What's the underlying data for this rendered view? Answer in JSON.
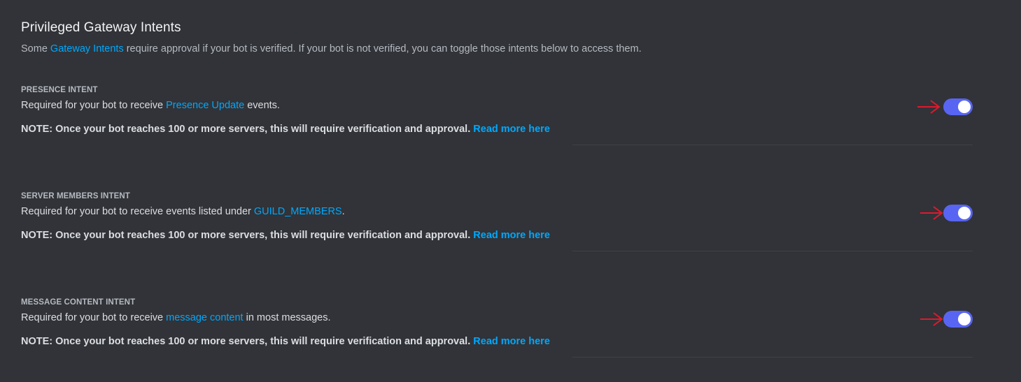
{
  "header": {
    "title": "Privileged Gateway Intents",
    "desc_prefix": "Some ",
    "desc_link": "Gateway Intents",
    "desc_suffix": " require approval if your bot is verified. If your bot is not verified, you can toggle those intents below to access them."
  },
  "intents": [
    {
      "title": "PRESENCE INTENT",
      "desc_prefix": "Required for your bot to receive ",
      "desc_link": "Presence Update",
      "desc_suffix": " events.",
      "note": "NOTE: Once your bot reaches 100 or more servers, this will require verification and approval.",
      "note_link": "Read more here",
      "enabled": true
    },
    {
      "title": "SERVER MEMBERS INTENT",
      "desc_prefix": "Required for your bot to receive events listed under ",
      "desc_link": "GUILD_MEMBERS",
      "desc_suffix": ".",
      "note": "NOTE: Once your bot reaches 100 or more servers, this will require verification and approval.",
      "note_link": "Read more here",
      "enabled": true
    },
    {
      "title": "MESSAGE CONTENT INTENT",
      "desc_prefix": "Required for your bot to receive ",
      "desc_link": "message content",
      "desc_suffix": " in most messages.",
      "note": "NOTE: Once your bot reaches 100 or more servers, this will require verification and approval.",
      "note_link": "Read more here",
      "enabled": true
    }
  ],
  "colors": {
    "background": "#313338",
    "accent": "#5865f2",
    "link": "#00a8fc",
    "annotation_arrow": "#e0192d"
  },
  "icons": {
    "annotation": "arrow-right-icon"
  }
}
